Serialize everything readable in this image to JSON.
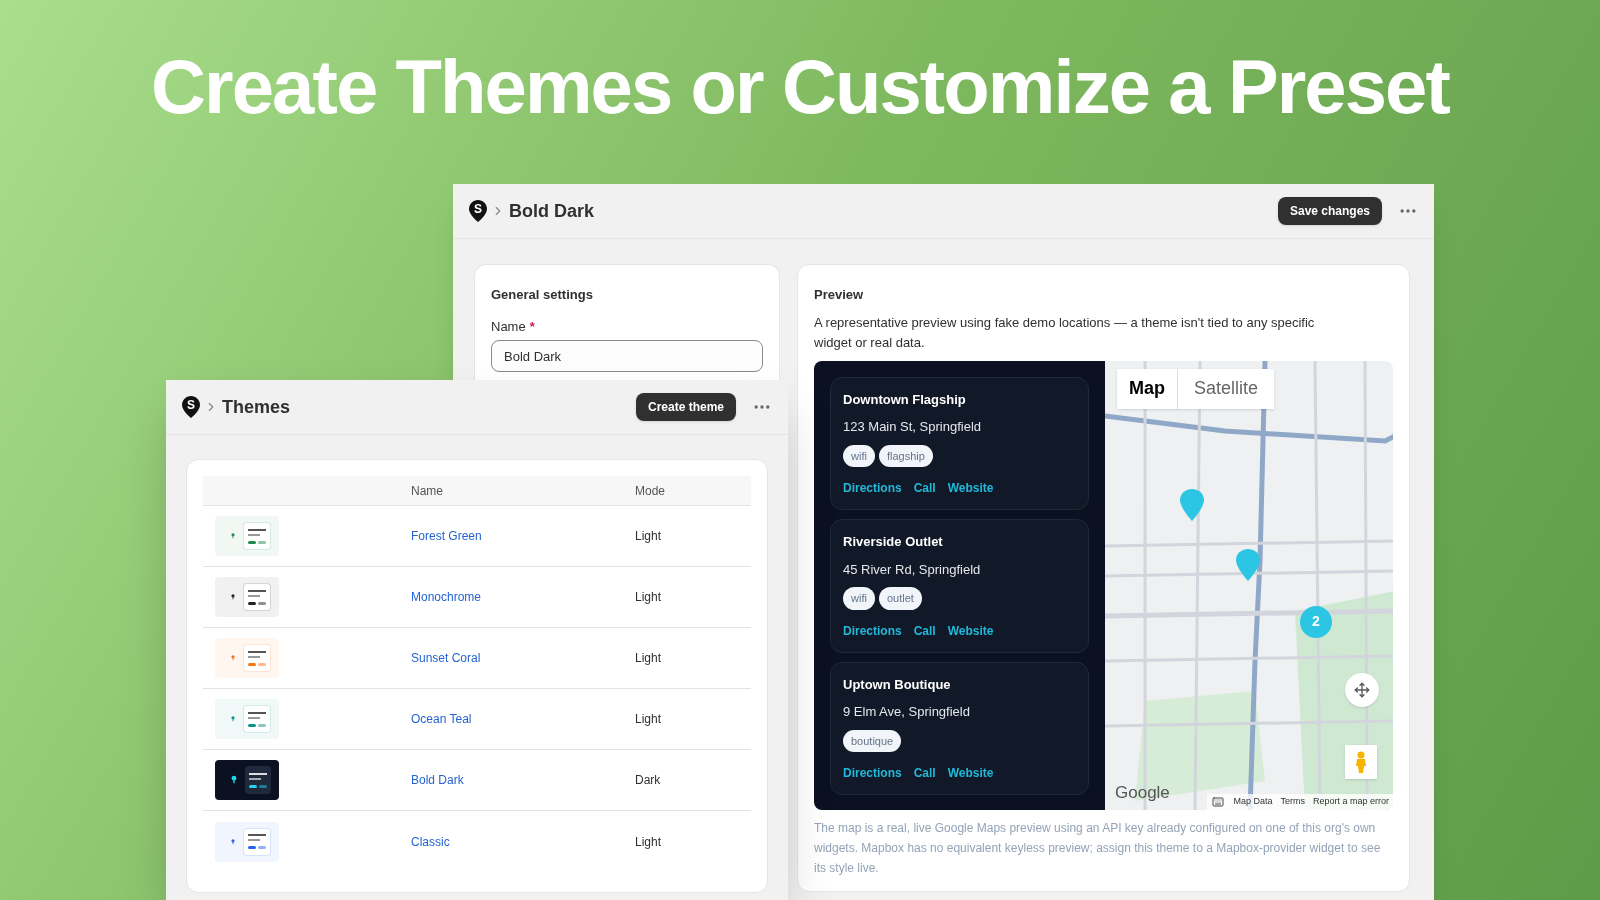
{
  "headline": "Create Themes or Customize a Preset",
  "editor": {
    "logo": "S",
    "breadcrumb": "Bold Dark",
    "save_button": "Save changes",
    "general": {
      "title": "General settings",
      "name_label": "Name",
      "required_mark": "*",
      "name_value": "Bold Dark"
    },
    "preview": {
      "title": "Preview",
      "description": "A representative preview using fake demo locations — a theme isn't tied to any specific widget or real data.",
      "locations": [
        {
          "name": "Downtown Flagship",
          "address": "123 Main St, Springfield",
          "tags": [
            "wifi",
            "flagship"
          ],
          "links": [
            "Directions",
            "Call",
            "Website"
          ]
        },
        {
          "name": "Riverside Outlet",
          "address": "45 River Rd, Springfield",
          "tags": [
            "wifi",
            "outlet"
          ],
          "links": [
            "Directions",
            "Call",
            "Website"
          ]
        },
        {
          "name": "Uptown Boutique",
          "address": "9 Elm Ave, Springfield",
          "tags": [
            "boutique"
          ],
          "links": [
            "Directions",
            "Call",
            "Website"
          ]
        }
      ],
      "map": {
        "tabs": [
          {
            "label": "Map",
            "selected": true
          },
          {
            "label": "Satellite",
            "selected": false
          }
        ],
        "cluster_count": "2",
        "logo": "Google",
        "attribution": [
          "Map Data",
          "Terms",
          "Report a map error"
        ]
      },
      "note": "The map is a real, live Google Maps preview using an API key already configured on one of this org's own widgets. Mapbox has no equivalent keyless preview; assign this theme to a Mapbox-provider widget to see its style live."
    }
  },
  "themes_window": {
    "logo": "S",
    "breadcrumb": "Themes",
    "create_button": "Create theme",
    "columns": [
      "Name",
      "Mode"
    ],
    "rows": [
      {
        "name": "Forest Green",
        "mode": "Light",
        "kind": "light",
        "color": "#1f8a4c"
      },
      {
        "name": "Monochrome",
        "mode": "Light",
        "kind": "light",
        "color": "#222222"
      },
      {
        "name": "Sunset Coral",
        "mode": "Light",
        "kind": "light",
        "color": "#f97316"
      },
      {
        "name": "Ocean Teal",
        "mode": "Light",
        "kind": "light",
        "color": "#0d9488"
      },
      {
        "name": "Bold Dark",
        "mode": "Dark",
        "kind": "dark",
        "color": "#22d3ee"
      },
      {
        "name": "Classic",
        "mode": "Light",
        "kind": "light",
        "color": "#2563eb"
      }
    ]
  }
}
